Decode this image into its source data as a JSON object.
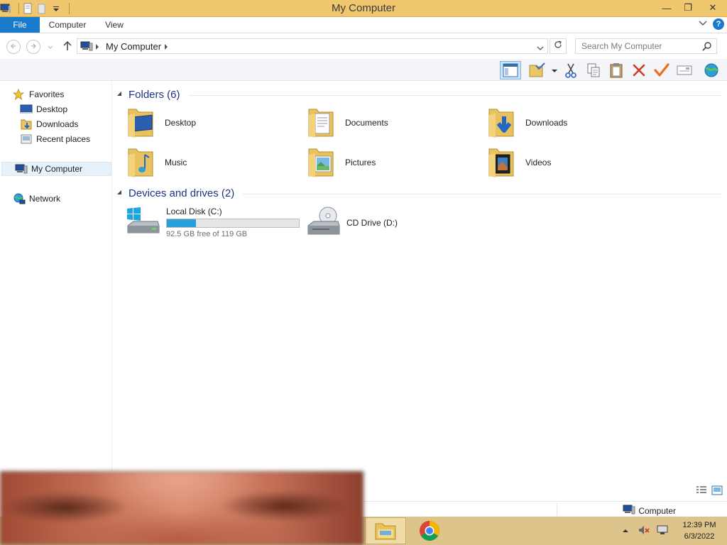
{
  "window": {
    "title": "My Computer",
    "minimize": "—",
    "maximize": "❐",
    "close": "✕"
  },
  "ribbon": {
    "tabs": [
      {
        "label": "File"
      },
      {
        "label": "Computer"
      },
      {
        "label": "View"
      }
    ]
  },
  "address": {
    "crumb": "My Computer",
    "search_placeholder": "Search My Computer"
  },
  "nav": {
    "favorites": "Favorites",
    "desktop": "Desktop",
    "downloads": "Downloads",
    "recent": "Recent places",
    "my_computer": "My Computer",
    "network": "Network"
  },
  "content": {
    "folders_header": "Folders (6)",
    "folders": [
      {
        "name": "Desktop",
        "icon": "desktop-folder-icon"
      },
      {
        "name": "Documents",
        "icon": "documents-folder-icon"
      },
      {
        "name": "Downloads",
        "icon": "downloads-folder-icon"
      },
      {
        "name": "Music",
        "icon": "music-folder-icon"
      },
      {
        "name": "Pictures",
        "icon": "pictures-folder-icon"
      },
      {
        "name": "Videos",
        "icon": "videos-folder-icon"
      }
    ],
    "drives_header": "Devices and drives (2)",
    "drives": [
      {
        "name": "Local Disk (C:)",
        "free": "92.5 GB free of 119 GB",
        "used_fraction": 0.223
      },
      {
        "name": "CD Drive (D:)"
      }
    ]
  },
  "status": {
    "computer": "Computer"
  },
  "taskbar": {
    "time": "12:39 PM",
    "date": "6/3/2022"
  },
  "colors": {
    "title_bar": "#f0c66e",
    "file_tab": "#1979ca",
    "accent_header": "#1e3287",
    "drive_bar": "#26a0da",
    "taskbar": "#ddc48a"
  }
}
